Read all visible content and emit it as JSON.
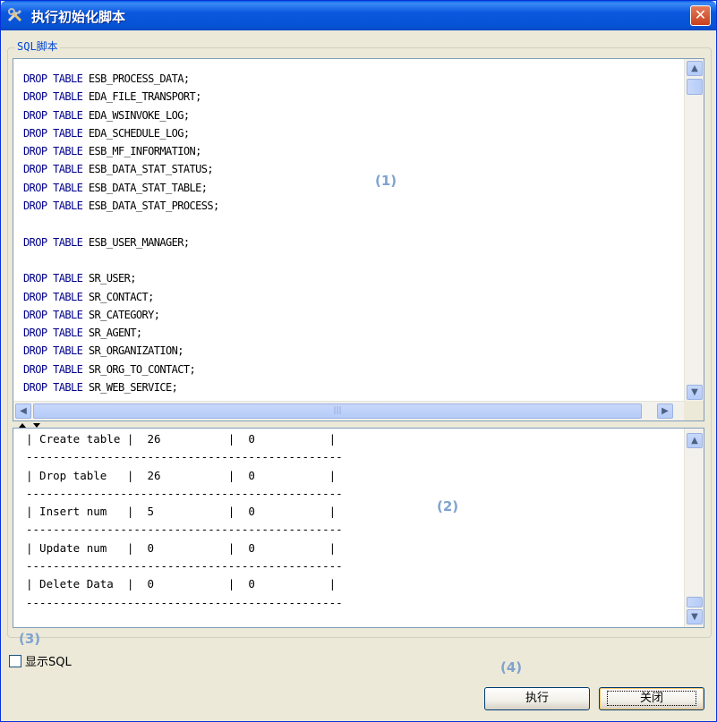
{
  "window": {
    "title": "执行初始化脚本",
    "close_glyph": "✕"
  },
  "group": {
    "label": "SQL脚本"
  },
  "script_pane": {
    "lines": [
      {
        "kw": "DROP TABLE",
        "rest": " ESB_PROCESS_DATA;"
      },
      {
        "kw": "DROP TABLE",
        "rest": " EDA_FILE_TRANSPORT;"
      },
      {
        "kw": "DROP TABLE",
        "rest": " EDA_WSINVOKE_LOG;"
      },
      {
        "kw": "DROP TABLE",
        "rest": " EDA_SCHEDULE_LOG;"
      },
      {
        "kw": "DROP TABLE",
        "rest": " ESB_MF_INFORMATION;"
      },
      {
        "kw": "DROP TABLE",
        "rest": " ESB_DATA_STAT_STATUS;"
      },
      {
        "kw": "DROP TABLE",
        "rest": " ESB_DATA_STAT_TABLE;"
      },
      {
        "kw": "DROP TABLE",
        "rest": " ESB_DATA_STAT_PROCESS;"
      },
      {
        "kw": "",
        "rest": ""
      },
      {
        "kw": "DROP TABLE",
        "rest": " ESB_USER_MANAGER;"
      },
      {
        "kw": "",
        "rest": ""
      },
      {
        "kw": "DROP TABLE",
        "rest": " SR_USER;"
      },
      {
        "kw": "DROP TABLE",
        "rest": " SR_CONTACT;"
      },
      {
        "kw": "DROP TABLE",
        "rest": " SR_CATEGORY;"
      },
      {
        "kw": "DROP TABLE",
        "rest": " SR_AGENT;"
      },
      {
        "kw": "DROP TABLE",
        "rest": " SR_ORGANIZATION;"
      },
      {
        "kw": "DROP TABLE",
        "rest": " SR_ORG_TO_CONTACT;"
      },
      {
        "kw": "DROP TABLE",
        "rest": " SR_WEB_SERVICE;"
      }
    ]
  },
  "result_pane": {
    "separator": "-----------------------------------------------",
    "rows": [
      {
        "label": "Create table",
        "c1": "26",
        "c2": "0"
      },
      {
        "label": "Drop table",
        "c1": "26",
        "c2": "0"
      },
      {
        "label": "Insert num",
        "c1": "5",
        "c2": "0"
      },
      {
        "label": "Update num",
        "c1": "0",
        "c2": "0"
      },
      {
        "label": "Delete Data",
        "c1": "0",
        "c2": "0"
      }
    ]
  },
  "checkbox": {
    "label": "显示SQL",
    "checked": false
  },
  "buttons": {
    "execute": "执行",
    "close": "关闭"
  },
  "markers": {
    "m1": "(1)",
    "m2": "(2)",
    "m3": "(3)",
    "m4": "(4)"
  },
  "scroll": {
    "up": "▲",
    "down": "▼",
    "left": "◀",
    "right": "▶",
    "grip": "|||"
  },
  "colors": {
    "titlebar": "#0a58de",
    "keyword": "#00008b",
    "group_label": "#0046d5",
    "marker": "#7fa3cf"
  }
}
